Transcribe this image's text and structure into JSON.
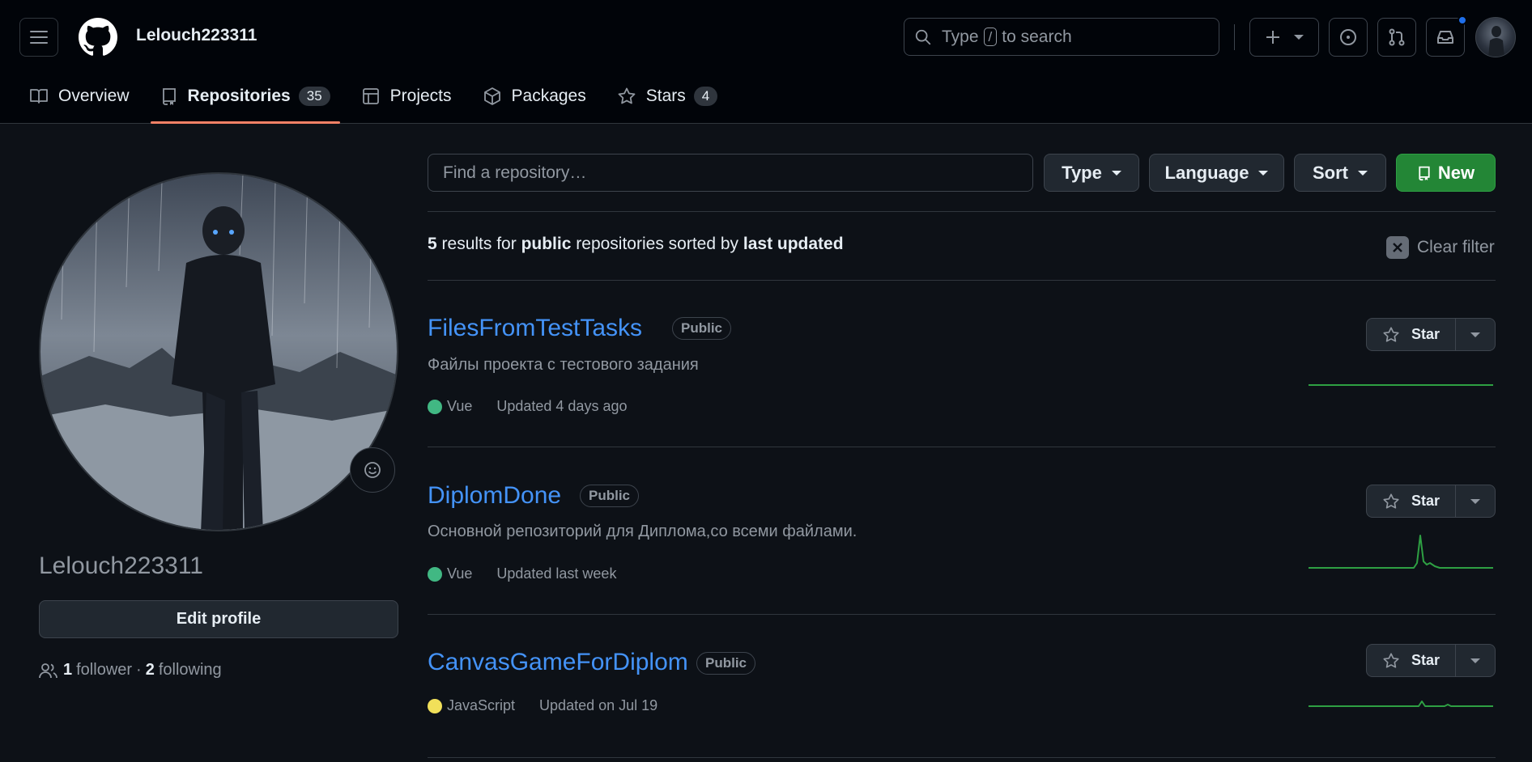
{
  "header": {
    "username": "Lelouch223311",
    "search": {
      "prefix": "Type",
      "key": "/",
      "suffix": "to search"
    }
  },
  "tabs": [
    {
      "label": "Overview"
    },
    {
      "label": "Repositories",
      "count": "35"
    },
    {
      "label": "Projects"
    },
    {
      "label": "Packages"
    },
    {
      "label": "Stars",
      "count": "4"
    }
  ],
  "profile": {
    "name": "Lelouch223311",
    "edit_label": "Edit profile",
    "followers_count": "1",
    "followers_label": "follower",
    "separator": "·",
    "following_count": "2",
    "following_label": "following"
  },
  "toolbar": {
    "find_placeholder": "Find a repository…",
    "type_label": "Type",
    "language_label": "Language",
    "sort_label": "Sort",
    "new_label": "New"
  },
  "results": {
    "count": "5",
    "text1": "results for",
    "visibility": "public",
    "text2": "repositories sorted by",
    "sort": "last updated",
    "clear_label": "Clear filter"
  },
  "repos": [
    {
      "name": "FilesFromTestTasks",
      "visibility": "Public",
      "description": "Файлы проекта с тестового задания",
      "language": "Vue",
      "language_color": "#41b883",
      "updated": "Updated 4 days ago",
      "star_label": "Star"
    },
    {
      "name": "DiplomDone",
      "visibility": "Public",
      "description": "Основной репозиторий для Диплома,со всеми файлами.",
      "language": "Vue",
      "language_color": "#41b883",
      "updated": "Updated last week",
      "star_label": "Star"
    },
    {
      "name": "CanvasGameForDiplom",
      "visibility": "Public",
      "description": "",
      "language": "JavaScript",
      "language_color": "#f1e05a",
      "updated": "Updated on Jul 19",
      "star_label": "Star"
    }
  ],
  "colors": {
    "accent": "#4493f8",
    "new_button": "#238636",
    "tab_underline": "#f78166",
    "sparkline": "#2ea043"
  }
}
